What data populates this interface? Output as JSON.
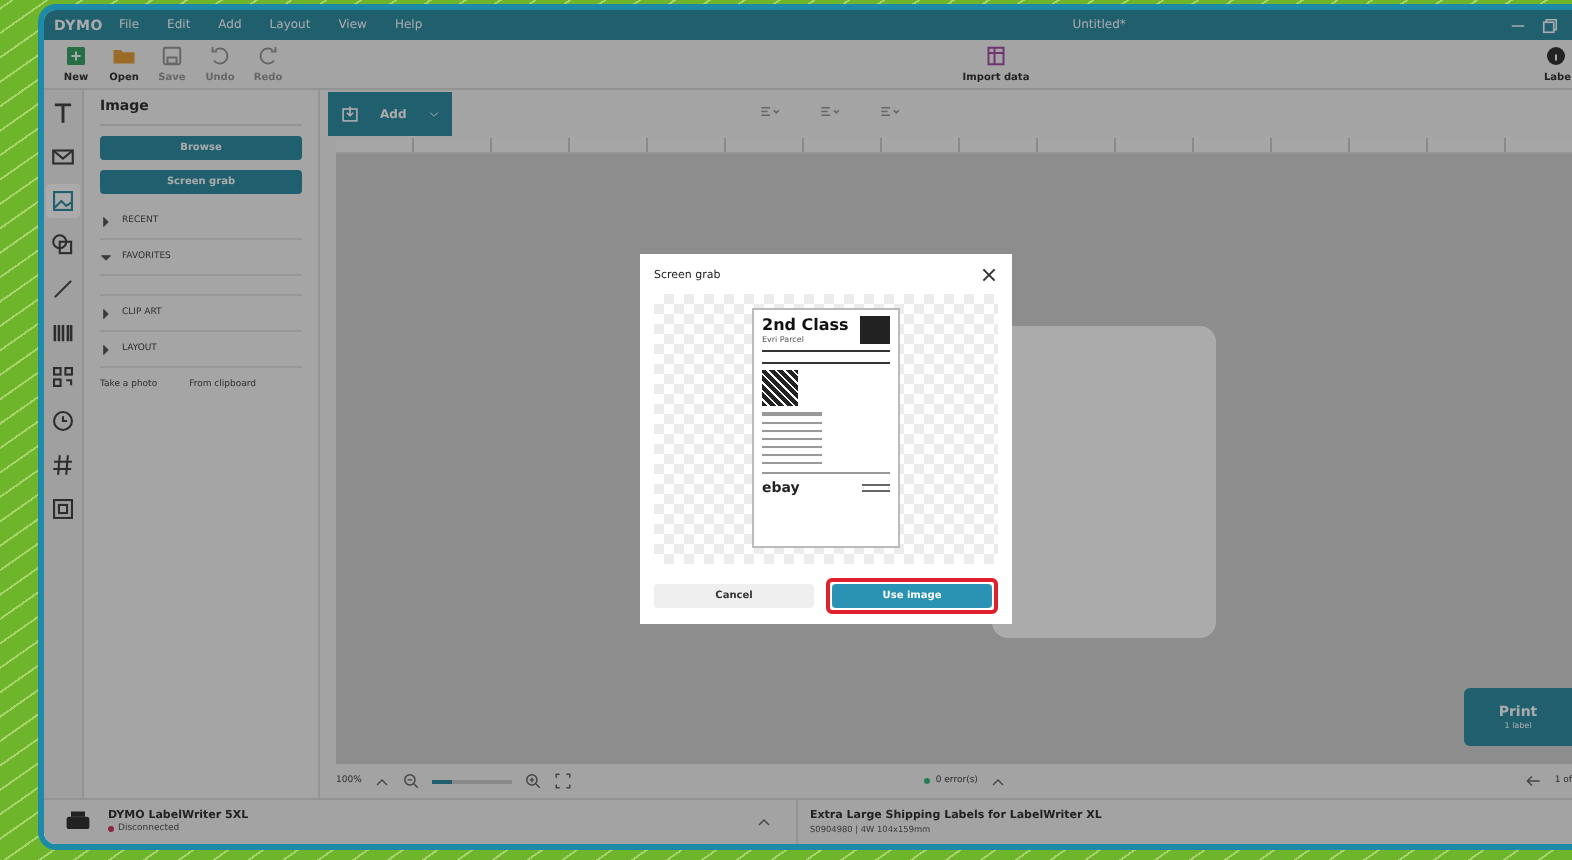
{
  "window": {
    "logo": "DYMO",
    "menu": [
      "File",
      "Edit",
      "Add",
      "Layout",
      "View",
      "Help"
    ],
    "title": "Untitled*"
  },
  "toolbar": [
    {
      "label": "New",
      "disabled": false
    },
    {
      "label": "Open",
      "disabled": false
    },
    {
      "label": "Save",
      "disabled": true
    },
    {
      "label": "Undo",
      "disabled": true
    },
    {
      "label": "Redo",
      "disabled": true
    }
  ],
  "import_data": "Import data",
  "label_button": "Labe",
  "rail": [
    {
      "selected": false
    },
    {
      "selected": false
    },
    {
      "selected": true
    },
    {
      "selected": false
    },
    {
      "selected": false
    },
    {
      "selected": false
    },
    {
      "selected": false
    },
    {
      "selected": false
    },
    {
      "selected": false
    },
    {
      "selected": false
    }
  ],
  "panel": {
    "title": "Image",
    "buttons": [
      "Browse",
      "Screen grab"
    ],
    "sections": [
      {
        "label": "RECENT",
        "expanded": false
      },
      {
        "label": "FAVORITES",
        "expanded": true
      },
      {
        "label": "CLIP ART",
        "expanded": false
      },
      {
        "label": "LAYOUT",
        "expanded": false
      }
    ],
    "links": [
      "Take a photo",
      "From clipboard"
    ]
  },
  "canvas": {
    "add_button": "Add",
    "print": {
      "label": "Print",
      "sub": "1 label"
    }
  },
  "zoom_bar": {
    "zoom": "100%",
    "level": 0.25,
    "errors": "0 error(s)",
    "page": "1 of"
  },
  "status_bar": {
    "printer": "DYMO LabelWriter 5XL",
    "printer_status": "Disconnected",
    "connected": false,
    "label_name": "Extra Large Shipping Labels for LabelWriter XL",
    "label_code": "S0904980 | 4W 104x159mm"
  },
  "dialog": {
    "title": "Screen grab",
    "preview": {
      "service": "2nd Class",
      "carrier": "Evri Parcel",
      "brand": "ebay"
    },
    "buttons": [
      {
        "label": "Cancel",
        "kind": "secondary",
        "highlighted": false
      },
      {
        "label": "Use image",
        "kind": "primary",
        "highlighted": true
      }
    ]
  }
}
